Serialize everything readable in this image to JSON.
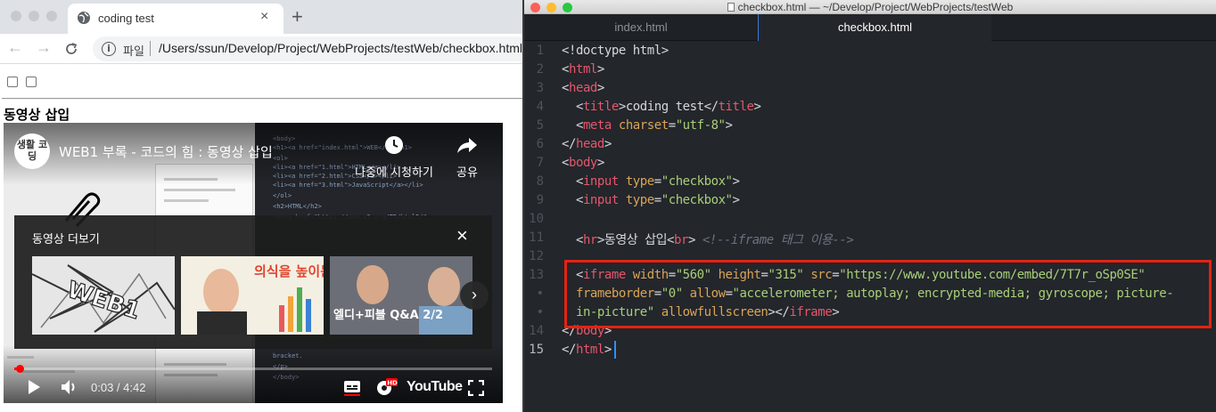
{
  "browser": {
    "tab_title": "coding test",
    "tab_close": "×",
    "new_tab": "+",
    "back": "←",
    "forward": "→",
    "reload": "C",
    "info": "i",
    "url_scheme_label": "파일",
    "url": "/Users/ssun/Develop/Project/WebProjects/testWeb/checkbox.html",
    "page_heading": "동영상 삽입"
  },
  "youtube": {
    "channel_avatar": "생활 코딩",
    "video_title": "WEB1 부록 - 코드의 힘 : 동영상 삽입",
    "watch_later": "나중에 시청하기",
    "share": "공유",
    "more_videos": "동영상 더보기",
    "close": "×",
    "next": "›",
    "thumbnails": [
      {
        "text": "WEB1"
      },
      {
        "text": "의식을 높이는법"
      },
      {
        "text": "엘디+피블 Q&A 2/2"
      }
    ],
    "progress_fraction": 0.011,
    "time": "0:03 / 4:42",
    "logo": "YouTube",
    "hd_badge": "HD"
  },
  "editor": {
    "window_title": "checkbox.html — ~/Develop/Project/WebProjects/testWeb",
    "tabs": [
      {
        "label": "index.html",
        "active": false
      },
      {
        "label": "checkbox.html",
        "active": true
      }
    ],
    "gutter": [
      "1",
      "2",
      "3",
      "4",
      "5",
      "6",
      "7",
      "8",
      "9",
      "10",
      "11",
      "12",
      "13",
      "•",
      "•",
      "14",
      "15"
    ],
    "current_line": "15",
    "lines": {
      "l1": "<!doctype html>",
      "l2_tag": "html",
      "l3_tag": "head",
      "l4_tag": "title",
      "l4_text": "coding test",
      "l5_tag": "meta",
      "l5_attr": "charset",
      "l5_val": "\"utf-8\"",
      "l6_tag": "head",
      "l7_tag": "body",
      "l8_tag": "input",
      "l8_attr": "type",
      "l8_val": "\"checkbox\"",
      "l11_tag1": "hr",
      "l11_text": "동영상 삽입",
      "l11_tag2": "br",
      "l11_comment": "<!--iframe 태그 이용-->",
      "l13_tag": "iframe",
      "l13_a1": "width",
      "l13_v1": "\"560\"",
      "l13_a2": "height",
      "l13_v2": "\"315\"",
      "l13_a3": "src",
      "l13_v3": "\"https://www.youtube.com/embed/7T7r_oSp0SE\"",
      "l13b_a1": "frameborder",
      "l13b_v1": "\"0\"",
      "l13b_a2": "allow",
      "l13b_v2": "\"accelerometer; autoplay; encrypted-media; gyroscope; picture-",
      "l13c_v": "in-picture\"",
      "l13c_a": "allowfullscreen",
      "l13c_close": "iframe",
      "l14_tag": "body",
      "l15_tag": "html"
    }
  },
  "colors": {
    "highlight_box": "#e42311",
    "tag": "#e5576b",
    "attribute": "#d9a457",
    "string": "#a8cf78",
    "youtube_red": "#ff0000",
    "editor_bg": "#23262b"
  }
}
